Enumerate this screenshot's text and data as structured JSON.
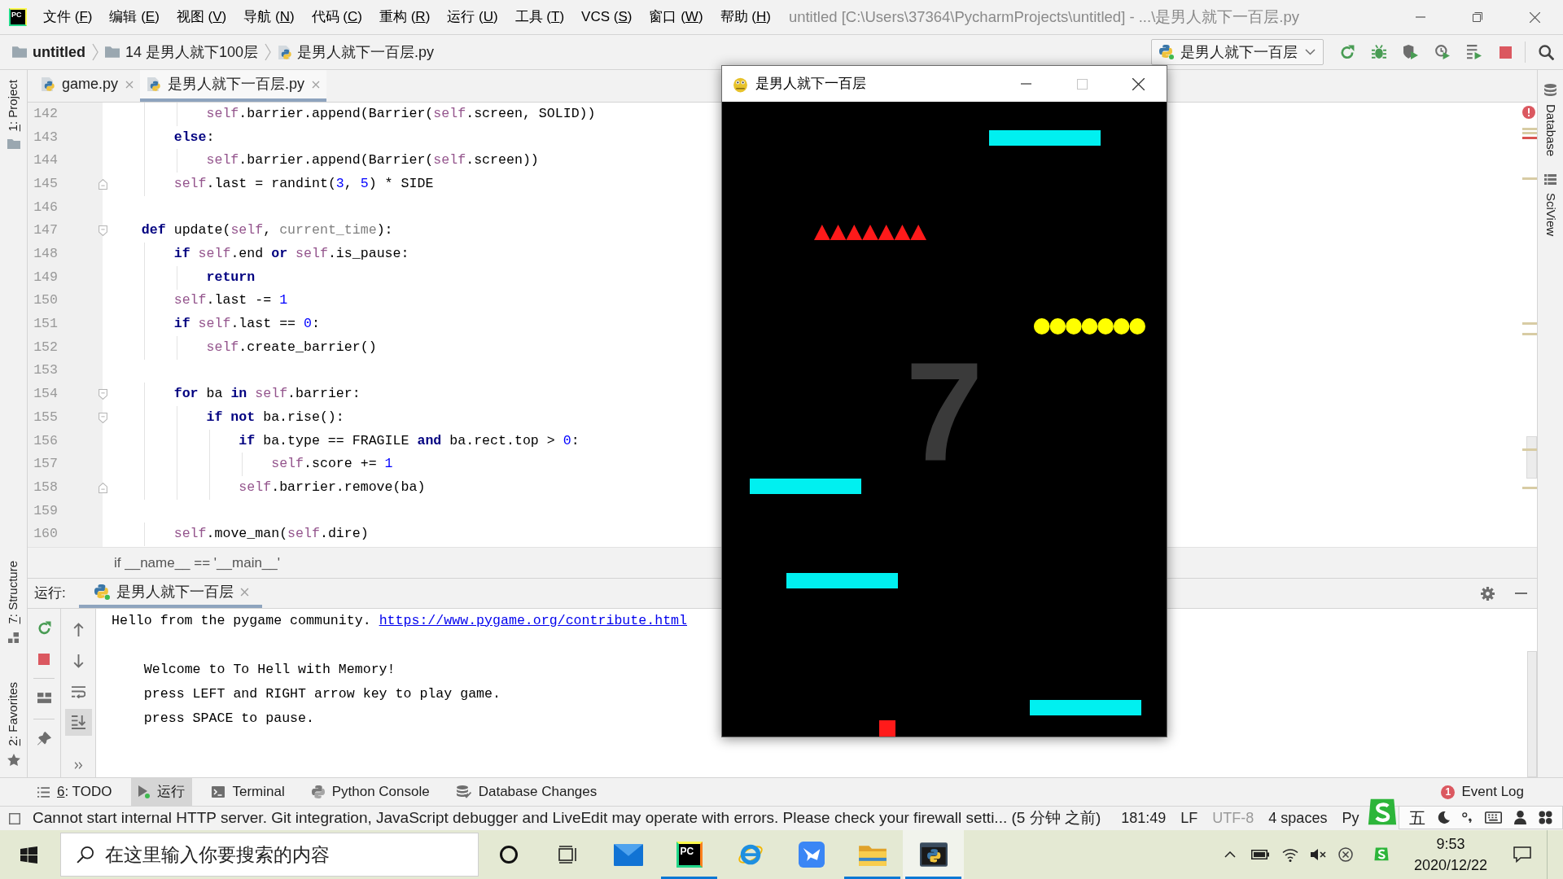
{
  "menu_bar": {
    "logo": "PC",
    "items": [
      "文件 (F)",
      "编辑 (E)",
      "视图 (V)",
      "导航 (N)",
      "代码 (C)",
      "重构 (R)",
      "运行 (U)",
      "工具 (T)",
      "VCS (S)",
      "窗口 (W)",
      "帮助 (H)"
    ],
    "title": "untitled [C:\\Users\\37364\\PycharmProjects\\untitled] - ...\\是男人就下一百层.py"
  },
  "nav_bar": {
    "breadcrumbs": [
      {
        "kind": "project",
        "label": "untitled"
      },
      {
        "kind": "folder",
        "label": "14 是男人就下100层"
      },
      {
        "kind": "python",
        "label": "是男人就下一百层.py"
      }
    ],
    "run_config": "是男人就下一百层"
  },
  "left_tool_windows": [
    {
      "kind": "project",
      "label": "1: Project"
    },
    {
      "kind": "structure",
      "label": "7: Structure"
    },
    {
      "kind": "favorites",
      "label": "2: Favorites"
    }
  ],
  "tabs": [
    {
      "label": "game.py",
      "selected": false
    },
    {
      "label": "是男人就下一百层.py",
      "selected": true
    }
  ],
  "editor": {
    "lines": [
      {
        "number": "142",
        "tokens": [
          {
            "kind": "self",
            "text": "            self"
          },
          {
            "kind": "plain",
            "text": ".barrier.append(Barrier("
          },
          {
            "kind": "self",
            "text": "self"
          },
          {
            "kind": "plain",
            "text": ".screen, SOLID))"
          }
        ]
      },
      {
        "number": "143",
        "tokens": [
          {
            "kind": "keyword",
            "text": "        else"
          },
          {
            "kind": "plain",
            "text": ":"
          }
        ]
      },
      {
        "number": "144",
        "tokens": [
          {
            "kind": "self",
            "text": "            self"
          },
          {
            "kind": "plain",
            "text": ".barrier.append(Barrier("
          },
          {
            "kind": "self",
            "text": "self"
          },
          {
            "kind": "plain",
            "text": ".screen))"
          }
        ]
      },
      {
        "number": "145",
        "fold": {
          "kind": "end"
        },
        "tokens": [
          {
            "kind": "self",
            "text": "        self"
          },
          {
            "kind": "plain",
            "text": ".last = randint("
          },
          {
            "kind": "number",
            "text": "3"
          },
          {
            "kind": "plain",
            "text": ", "
          },
          {
            "kind": "number",
            "text": "5"
          },
          {
            "kind": "plain",
            "text": ") * SIDE"
          }
        ]
      },
      {
        "number": "146"
      },
      {
        "number": "147",
        "fold": {
          "kind": "start"
        },
        "tokens": [
          {
            "kind": "keyword",
            "text": "    def"
          },
          {
            "kind": "plain",
            "text": " update("
          },
          {
            "kind": "self",
            "text": "self"
          },
          {
            "kind": "plain",
            "text": ", "
          },
          {
            "kind": "parameter",
            "text": "current_time"
          },
          {
            "kind": "plain",
            "text": "):"
          }
        ]
      },
      {
        "number": "148",
        "tokens": [
          {
            "kind": "keyword",
            "text": "        if "
          },
          {
            "kind": "self",
            "text": "self"
          },
          {
            "kind": "plain",
            "text": ".end "
          },
          {
            "kind": "keyword",
            "text": "or "
          },
          {
            "kind": "self",
            "text": "self"
          },
          {
            "kind": "plain",
            "text": ".is_pause:"
          }
        ]
      },
      {
        "number": "149",
        "tokens": [
          {
            "kind": "keyword",
            "text": "            return"
          }
        ]
      },
      {
        "number": "150",
        "tokens": [
          {
            "kind": "self",
            "text": "        self"
          },
          {
            "kind": "plain",
            "text": ".last -= "
          },
          {
            "kind": "number",
            "text": "1"
          }
        ]
      },
      {
        "number": "151",
        "tokens": [
          {
            "kind": "keyword",
            "text": "        if "
          },
          {
            "kind": "self",
            "text": "self"
          },
          {
            "kind": "plain",
            "text": ".last == "
          },
          {
            "kind": "number",
            "text": "0"
          },
          {
            "kind": "plain",
            "text": ":"
          }
        ]
      },
      {
        "number": "152",
        "tokens": [
          {
            "kind": "self",
            "text": "            self"
          },
          {
            "kind": "plain",
            "text": ".create_barrier()"
          }
        ]
      },
      {
        "number": "153"
      },
      {
        "number": "154",
        "fold": {
          "kind": "start"
        },
        "tokens": [
          {
            "kind": "keyword",
            "text": "        for"
          },
          {
            "kind": "plain",
            "text": " ba "
          },
          {
            "kind": "keyword",
            "text": "in "
          },
          {
            "kind": "self",
            "text": "self"
          },
          {
            "kind": "plain",
            "text": ".barrier:"
          }
        ]
      },
      {
        "number": "155",
        "fold": {
          "kind": "start"
        },
        "tokens": [
          {
            "kind": "keyword",
            "text": "            if not"
          },
          {
            "kind": "plain",
            "text": " ba.rise():"
          }
        ]
      },
      {
        "number": "156",
        "tokens": [
          {
            "kind": "keyword",
            "text": "                if"
          },
          {
            "kind": "plain",
            "text": " ba.type == FRAGILE "
          },
          {
            "kind": "keyword",
            "text": "and"
          },
          {
            "kind": "plain",
            "text": " ba.rect.top > "
          },
          {
            "kind": "number",
            "text": "0"
          },
          {
            "kind": "plain",
            "text": ":"
          }
        ]
      },
      {
        "number": "157",
        "tokens": [
          {
            "kind": "self",
            "text": "                    self"
          },
          {
            "kind": "plain",
            "text": ".score += "
          },
          {
            "kind": "number",
            "text": "1"
          }
        ]
      },
      {
        "number": "158",
        "fold": {
          "kind": "end"
        },
        "tokens": [
          {
            "kind": "self",
            "text": "                self"
          },
          {
            "kind": "plain",
            "text": ".barrier.remove(ba)"
          }
        ]
      },
      {
        "number": "159"
      },
      {
        "number": "160",
        "tokens": [
          {
            "kind": "self",
            "text": "        self"
          },
          {
            "kind": "plain",
            "text": ".move_man("
          },
          {
            "kind": "self",
            "text": "self"
          },
          {
            "kind": "plain",
            "text": ".dire)"
          }
        ]
      }
    ],
    "breadcrumb": "if __name__ == '__main__'"
  },
  "right_tool_windows": [
    {
      "kind": "database",
      "label": "Database"
    },
    {
      "kind": "sciview",
      "label": "SciView"
    }
  ],
  "run_panel": {
    "title": "运行:",
    "tab": {
      "label": "是男人就下一百层",
      "selected": true
    },
    "console": [
      {
        "kind": "output",
        "text": "Hello from the pygame community.",
        "link": "https://www.pygame.org/contribute.html"
      },
      {
        "kind": "blank"
      },
      {
        "kind": "output",
        "text": "    Welcome to To Hell with Memory!"
      },
      {
        "kind": "output",
        "text": "    press LEFT and RIGHT arrow key to play game."
      },
      {
        "kind": "output",
        "text": "    press SPACE to pause."
      }
    ]
  },
  "tool_window_bar": {
    "items": [
      {
        "kind": "todo",
        "label": "6: TODO",
        "selected": false
      },
      {
        "kind": "run",
        "label": "运行",
        "selected": true
      },
      {
        "kind": "terminal",
        "label": "Terminal",
        "selected": false
      },
      {
        "kind": "python_console",
        "label": "Python Console",
        "selected": false
      },
      {
        "kind": "database_changes",
        "label": "Database Changes",
        "selected": false
      }
    ],
    "event_log": {
      "label": "Event Log",
      "count": "1"
    }
  },
  "status_bar": {
    "message": "Cannot start internal HTTP server. Git integration, JavaScript debugger and LiveEdit may operate with errors. Please check your firewall setti... (5 分钟 之前)",
    "items": [
      {
        "text": "181:49",
        "disabled": false
      },
      {
        "text": "LF",
        "disabled": false
      },
      {
        "text": "UTF-8",
        "disabled": true
      },
      {
        "text": "4 spaces",
        "disabled": false
      },
      {
        "text": "Py",
        "disabled": false
      }
    ]
  },
  "ime_toolbar": {
    "mode": "五"
  },
  "taskbar": {
    "search_placeholder": "在这里输入你要搜索的内容",
    "apps": [
      {
        "kind": "mail",
        "running": false,
        "selected": false
      },
      {
        "kind": "ide",
        "label": "PC",
        "running": true,
        "selected": false
      },
      {
        "kind": "browser",
        "running": false,
        "selected": false
      },
      {
        "kind": "bird",
        "running": false,
        "selected": false
      },
      {
        "kind": "files",
        "running": true,
        "selected": false
      },
      {
        "kind": "python",
        "running": true,
        "selected": true
      }
    ],
    "clock": {
      "time": "9:53",
      "date": "2020/12/22"
    }
  },
  "game_window": {
    "title": "是男人就下一百层",
    "controls": [
      {
        "kind": "minimize",
        "disabled": false
      },
      {
        "kind": "maximize",
        "disabled": true
      },
      {
        "kind": "close",
        "disabled": false
      }
    ],
    "score": "7",
    "objects": [
      {
        "kind": "platform"
      },
      {
        "kind": "spikes"
      },
      {
        "kind": "balls"
      },
      {
        "kind": "platform"
      },
      {
        "kind": "platform"
      },
      {
        "kind": "platform"
      },
      {
        "kind": "player"
      }
    ]
  }
}
